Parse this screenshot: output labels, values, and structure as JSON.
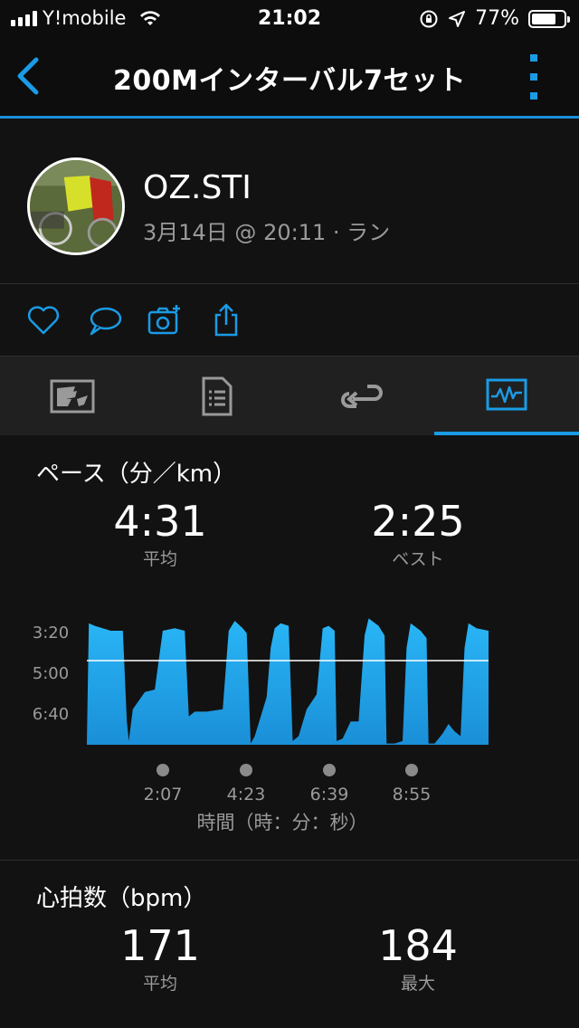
{
  "status_bar": {
    "carrier": "Y!mobile",
    "time": "21:02",
    "battery": "77%",
    "battery_level": 0.77
  },
  "nav": {
    "title": "200Mインターバル7セット",
    "back_icon": "chevron-left-icon",
    "more_icon": "more-vertical-icon"
  },
  "profile": {
    "name": "OZ.STI",
    "meta": "3月14日 @ 20:11 · ラン"
  },
  "actions": [
    "heart-icon",
    "comment-icon",
    "camera-add-icon",
    "share-icon"
  ],
  "tabs": [
    {
      "icon": "summary-icon",
      "active": false
    },
    {
      "icon": "details-icon",
      "active": false
    },
    {
      "icon": "laps-icon",
      "active": false
    },
    {
      "icon": "charts-icon",
      "active": true
    }
  ],
  "pace": {
    "title": "ペース（分／km）",
    "avg_value": "4:31",
    "avg_label": "平均",
    "best_value": "2:25",
    "best_label": "ベスト"
  },
  "heart_rate": {
    "title": "心拍数（bpm）",
    "avg_value": "171",
    "avg_label": "平均",
    "max_value": "184",
    "max_label": "最大"
  },
  "colors": {
    "accent": "#1a9be6",
    "background": "#121212",
    "muted": "#9a9a9a"
  },
  "chart_data": {
    "type": "area",
    "title": "ペース（分／km）",
    "xlabel": "時間（時：分：秒）",
    "ylabel": "",
    "y_tick_labels": [
      "3:20",
      "5:00",
      "6:40"
    ],
    "x_tick_labels": [
      "2:07",
      "4:23",
      "6:39",
      "8:55"
    ],
    "average_line": "4:31",
    "series": [
      {
        "values": [
          [
            0.0,
            7.9
          ],
          [
            0.05,
            3.0
          ],
          [
            0.2,
            3.1
          ],
          [
            0.6,
            3.3
          ],
          [
            0.9,
            3.3
          ],
          [
            1.0,
            7.0
          ],
          [
            1.05,
            7.8
          ],
          [
            1.15,
            6.5
          ],
          [
            1.45,
            5.8
          ],
          [
            1.7,
            5.7
          ],
          [
            1.9,
            3.3
          ],
          [
            2.2,
            3.2
          ],
          [
            2.45,
            3.3
          ],
          [
            2.55,
            6.8
          ],
          [
            2.7,
            6.6
          ],
          [
            3.0,
            6.6
          ],
          [
            3.4,
            6.5
          ],
          [
            3.55,
            3.3
          ],
          [
            3.7,
            2.9
          ],
          [
            3.9,
            3.2
          ],
          [
            4.0,
            3.4
          ],
          [
            4.1,
            7.9
          ],
          [
            4.2,
            7.6
          ],
          [
            4.5,
            6.0
          ],
          [
            4.6,
            4.0
          ],
          [
            4.7,
            3.2
          ],
          [
            4.85,
            3.0
          ],
          [
            5.05,
            3.1
          ],
          [
            5.15,
            7.8
          ],
          [
            5.3,
            7.6
          ],
          [
            5.5,
            6.5
          ],
          [
            5.75,
            5.9
          ],
          [
            5.9,
            3.2
          ],
          [
            6.05,
            3.1
          ],
          [
            6.2,
            3.3
          ],
          [
            6.25,
            7.8
          ],
          [
            6.4,
            7.7
          ],
          [
            6.6,
            7.0
          ],
          [
            6.8,
            7.0
          ],
          [
            6.95,
            3.5
          ],
          [
            7.05,
            2.8
          ],
          [
            7.3,
            3.1
          ],
          [
            7.45,
            3.5
          ],
          [
            7.5,
            7.9
          ],
          [
            7.7,
            7.9
          ],
          [
            7.9,
            7.8
          ],
          [
            8.0,
            4.0
          ],
          [
            8.1,
            3.0
          ],
          [
            8.35,
            3.3
          ],
          [
            8.5,
            3.6
          ],
          [
            8.55,
            7.9
          ],
          [
            8.7,
            7.9
          ],
          [
            8.9,
            7.5
          ],
          [
            9.05,
            7.1
          ],
          [
            9.2,
            7.4
          ],
          [
            9.35,
            7.6
          ],
          [
            9.45,
            4.0
          ],
          [
            9.55,
            3.0
          ],
          [
            9.75,
            3.2
          ],
          [
            10.05,
            3.3
          ]
        ]
      }
    ]
  }
}
